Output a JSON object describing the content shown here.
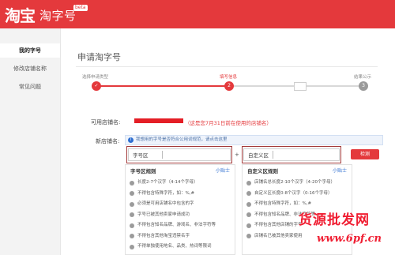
{
  "header": {
    "logo": "淘宝",
    "product": "淘字号",
    "badge": "beta"
  },
  "sidebar": {
    "items": [
      {
        "label": "我的字号",
        "active": true
      },
      {
        "label": "修改店铺名称",
        "active": false
      },
      {
        "label": "常见问题",
        "active": false
      }
    ]
  },
  "main": {
    "title": "申请淘字号",
    "steps": [
      {
        "label": "选择申请类型",
        "num": "✓",
        "state": "done"
      },
      {
        "label": "填写信息",
        "num": "2",
        "state": "current"
      },
      {
        "label": "结果公示",
        "num": "3",
        "state": "todo"
      }
    ],
    "form": {
      "usable_label": "可用店铺名:",
      "usable_note": "（这是您7月31日前在使用的店铺名）",
      "new_label": "新店铺名:",
      "tip": "我想用的字号是否符合公用词规范，请点击这里",
      "field1_label": "字号区",
      "plus": "+",
      "field2_label": "自定义区",
      "check_button": "检测"
    },
    "panel_left": {
      "title": "字号区规则",
      "link": "小贴士",
      "rules": [
        "长度2-7个汉字（4-14个字母）",
        "不得包含特殊字符，如：%,#",
        "必须是可用店铺名中包含的字",
        "字号已被其他卖家申请成功",
        "不得包含知名品牌、游戏名、非法字符等",
        "不得包含其他淘宝违禁名字",
        "不得单独使用地名、品类、热词等限词"
      ]
    },
    "panel_right": {
      "title": "自定义区规则",
      "link": "小贴士",
      "rules": [
        "店铺名总长度2-10个汉字（4-20个字母）",
        "自定义区长度0-8个汉字（0-16个字母）",
        "不得包含特殊字符，如：%,#",
        "不得包含知名品牌、非法字符等",
        "不得包含其他店铺的字号",
        "店铺名已被其他卖家使用"
      ]
    }
  },
  "watermark": {
    "main": "货源批发网",
    "sub": "www.6pf.cn"
  },
  "colors": {
    "brand": "#e4393c",
    "link": "#2f6fd1"
  }
}
